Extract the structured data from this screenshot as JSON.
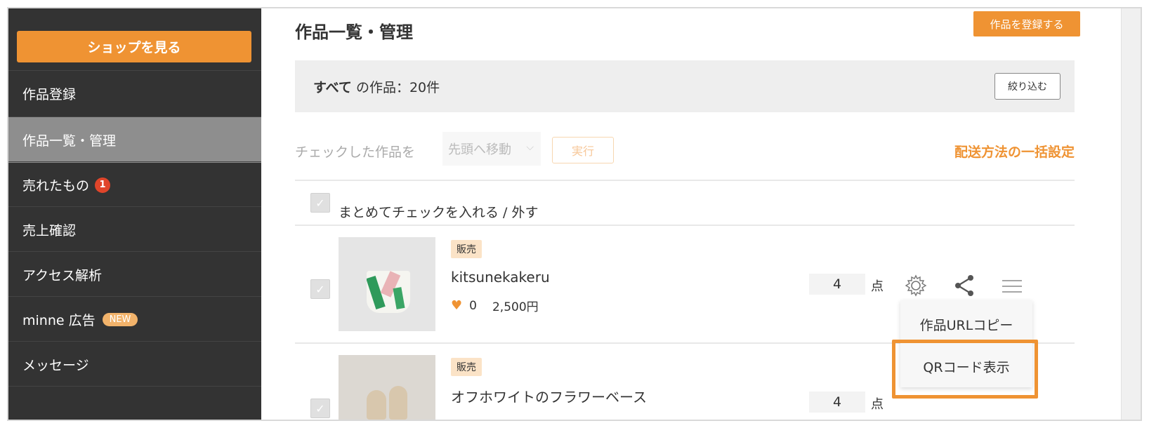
{
  "sidebar": {
    "shop_button": "ショップを見る",
    "items": [
      {
        "label": "作品登録"
      },
      {
        "label": "作品一覧・管理"
      },
      {
        "label": "売れたもの",
        "badge": "1"
      },
      {
        "label": "売上確認"
      },
      {
        "label": "アクセス解析"
      },
      {
        "label": "minne 広告",
        "badge_new": "NEW"
      },
      {
        "label": "メッセージ"
      }
    ]
  },
  "main": {
    "title": "作品一覧・管理",
    "register_button": "作品を登録する",
    "filter": {
      "scope": "すべて",
      "count_text": " の作品：20件",
      "button": "絞り込む"
    },
    "bulk": {
      "label": "チェックした作品を",
      "select_value": "先頭へ移動",
      "exec_button": "実行",
      "shipping_link": "配送方法の一括設定"
    },
    "select_all_label": "まとめてチェックを入れる / 外す",
    "items": [
      {
        "tag": "販売",
        "name": "kitsunekakeru",
        "likes": "0",
        "price": "2,500円",
        "qty": "4",
        "qty_unit": "点"
      },
      {
        "tag": "販売",
        "name": "オフホワイトのフラワーベース",
        "qty": "4",
        "qty_unit": "点"
      }
    ],
    "menu": {
      "copy_url": "作品URLコピー",
      "show_qr": "QRコード表示"
    }
  },
  "icons": {
    "check": "✓",
    "heart": "♥",
    "chevron": "⌵",
    "settings": "gear-icon",
    "share": "share-icon",
    "menu": "hamburger-icon"
  },
  "colors": {
    "accent": "#ef9333",
    "sidebar_bg": "#333333",
    "sidebar_active": "#8e8e8e",
    "badge_red": "#e0452a"
  }
}
